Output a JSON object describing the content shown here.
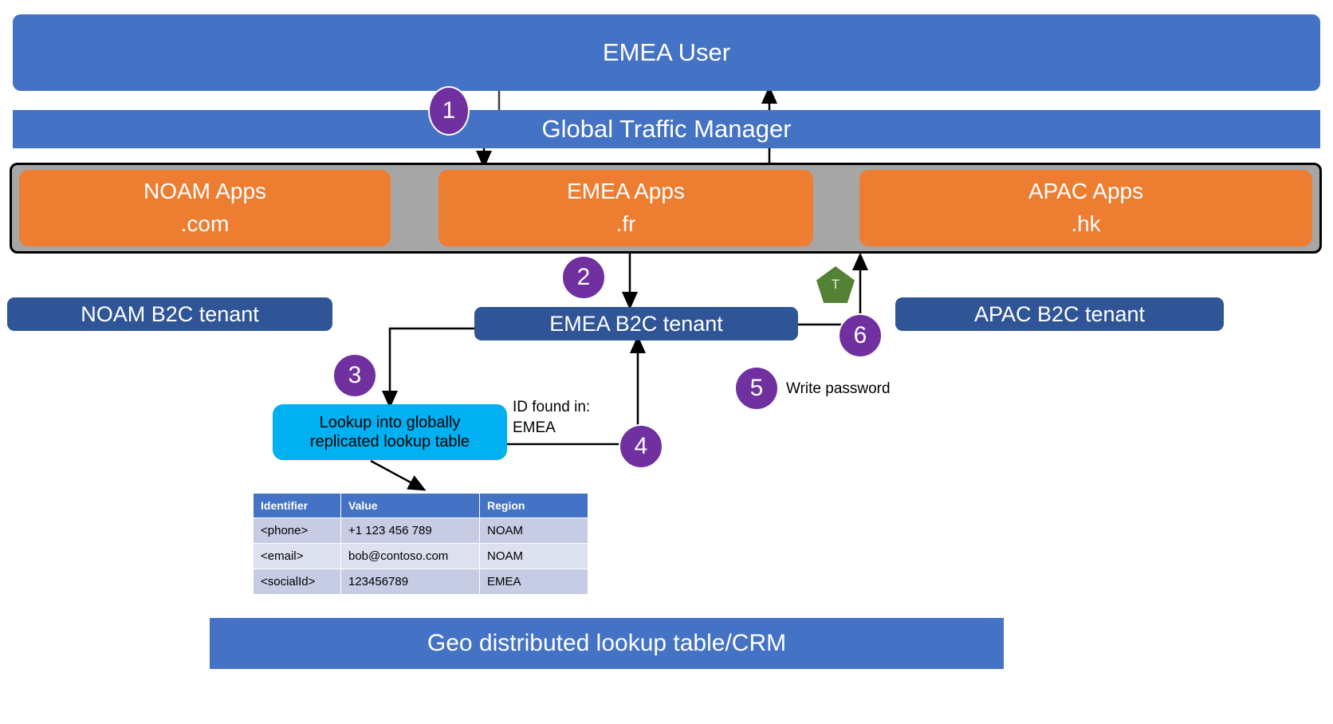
{
  "diagram": {
    "title": "EMEA User",
    "top_bars": [
      {
        "label": "EMEA User"
      },
      {
        "label": "Global Traffic Manager"
      }
    ],
    "apps": [
      {
        "name": "NOAM Apps",
        "domain": ".com"
      },
      {
        "name": "EMEA Apps",
        "domain": ".fr"
      },
      {
        "name": "APAC Apps",
        "domain": ".hk"
      }
    ],
    "tenants": [
      {
        "label": "NOAM B2C tenant"
      },
      {
        "label": "EMEA B2C tenant"
      },
      {
        "label": "APAC B2C tenant"
      }
    ],
    "lookup_box": {
      "line1": "Lookup into globally",
      "line2": "replicated lookup table"
    },
    "annotations": [
      {
        "text": "ID found in:\nEMEA"
      },
      {
        "text": "Write password"
      }
    ],
    "steps": [
      {
        "number": "1"
      },
      {
        "number": "2"
      },
      {
        "number": "3"
      },
      {
        "number": "4"
      },
      {
        "number": "5"
      },
      {
        "number": "6"
      }
    ],
    "token": {
      "label": "T"
    },
    "bottom_bar": {
      "label": "Geo distributed lookup table/CRM"
    },
    "table": {
      "columns": [
        "Identifier",
        "Value",
        "Region"
      ],
      "rows": [
        [
          "<phone>",
          "+1 123 456 789",
          "NOAM"
        ],
        [
          "<email>",
          "bob@contoso.com",
          "NOAM"
        ],
        [
          "<socialId>",
          "123456789",
          "EMEA"
        ]
      ]
    },
    "colors": {
      "blue": "#4472C4",
      "orange": "#ED7D31",
      "dark_blue": "#2F5597",
      "purple": "#7030A0",
      "cyan": "#00B0F0",
      "green": "#548235",
      "grey": "#A6A6A6",
      "row_odd": "#C5CCE3",
      "row_even": "#DCE0EF"
    }
  }
}
